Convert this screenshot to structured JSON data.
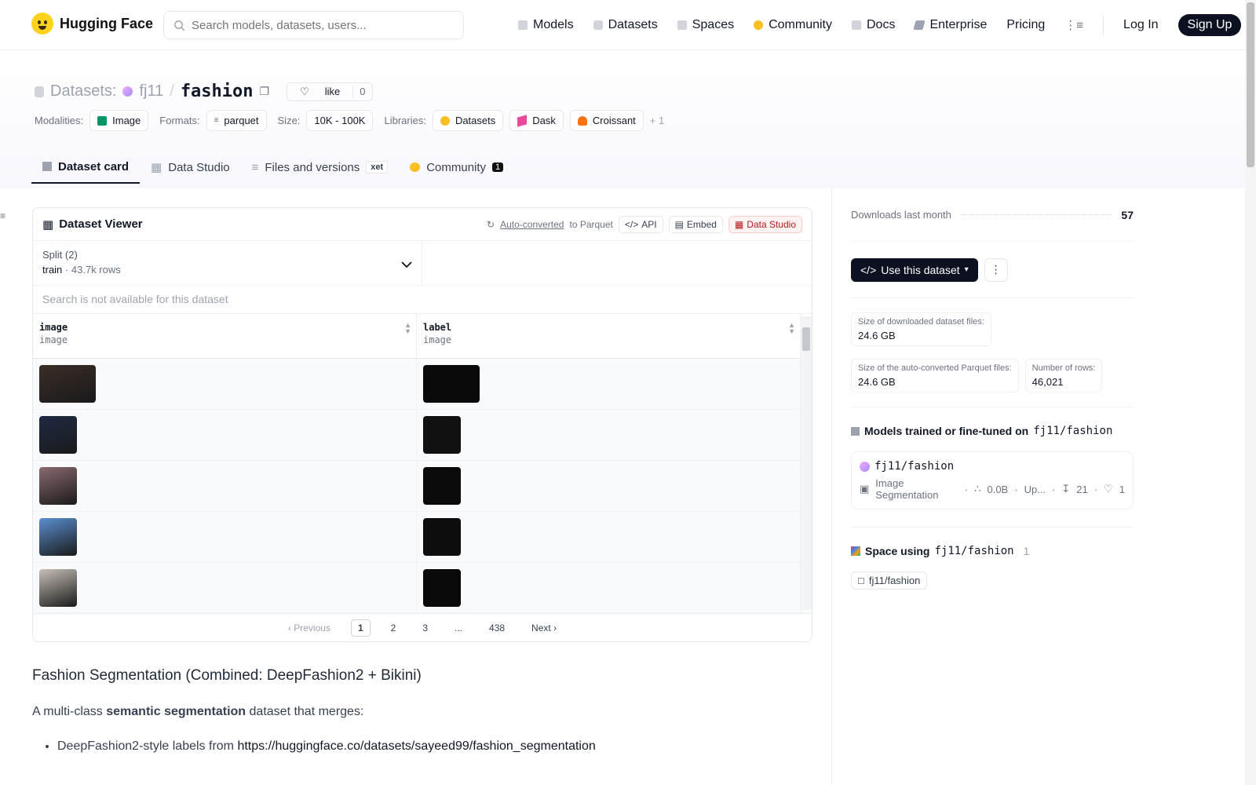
{
  "nav": {
    "logo_text": "Hugging Face",
    "search_placeholder": "Search models, datasets, users...",
    "links": [
      {
        "label": "Models",
        "icon": "cube-icon",
        "color": "#9ca3af"
      },
      {
        "label": "Datasets",
        "icon": "database-icon",
        "color": "#9ca3af"
      },
      {
        "label": "Spaces",
        "icon": "grid-icon",
        "color": "#9ca3af"
      },
      {
        "label": "Community",
        "icon": "community-icon",
        "color": "#fbbf24"
      },
      {
        "label": "Docs",
        "icon": "book-icon",
        "color": "#9ca3af"
      },
      {
        "label": "Enterprise",
        "icon": "enterprise-icon",
        "color": "#6b7280"
      },
      {
        "label": "Pricing"
      }
    ],
    "login": "Log In",
    "signup": "Sign Up"
  },
  "header": {
    "section": "Datasets:",
    "owner": "fj11",
    "repo": "fashion",
    "like_label": "like",
    "like_count": "0",
    "tags_labels": {
      "modalities": "Modalities:",
      "formats": "Formats:",
      "size": "Size:",
      "libraries": "Libraries:"
    },
    "modality": "Image",
    "format": "parquet",
    "size": "10K - 100K",
    "libraries": [
      "Datasets",
      "Dask",
      "Croissant"
    ],
    "more_libraries": "+ 1",
    "tabs": [
      {
        "label": "Dataset card",
        "active": true
      },
      {
        "label": "Data Studio"
      },
      {
        "label": "Files and versions",
        "badge": "xet"
      },
      {
        "label": "Community",
        "count": "1"
      }
    ]
  },
  "viewer": {
    "title": "Dataset Viewer",
    "auto_converted": "Auto-converted",
    "to_parquet": "to Parquet",
    "api": "API",
    "embed": "Embed",
    "data_studio": "Data Studio",
    "split_label": "Split (2)",
    "split_value": "train",
    "split_rows": "43.7k rows",
    "search_na": "Search is not available for this dataset",
    "columns": [
      {
        "name": "image",
        "type": "image"
      },
      {
        "name": "label",
        "type": "image"
      }
    ],
    "rows": [
      {
        "image_color": "#3a2e28",
        "label_color": "#0a0a0a",
        "wide": true
      },
      {
        "image_color": "#1e2a44",
        "label_color": "#111111",
        "wide": false
      },
      {
        "image_color": "#8a6a70",
        "label_color": "#0b0b0b",
        "wide": false
      },
      {
        "image_color": "#5a8fd0",
        "label_color": "#0d0d0d",
        "wide": false
      },
      {
        "image_color": "#c8c0b8",
        "label_color": "#0a0a0a",
        "wide": false
      }
    ],
    "pager": {
      "prev": "Previous",
      "pages": [
        "1",
        "2",
        "3",
        "...",
        "438"
      ],
      "next": "Next"
    }
  },
  "readme": {
    "heading": "Fashion Segmentation (Combined: DeepFashion2 + Bikini)",
    "intro_pre": "A multi-class ",
    "intro_bold": "semantic segmentation",
    "intro_post": " dataset that merges:",
    "bullet_pre": "DeepFashion2-style labels from ",
    "bullet_link": "https://huggingface.co/datasets/sayeed99/fashion_segmentation"
  },
  "sidebar": {
    "downloads_label": "Downloads last month",
    "downloads_value": "57",
    "use_dataset": "Use this dataset",
    "stats": [
      {
        "k": "Size of downloaded dataset files:",
        "v": "24.6 GB"
      },
      {
        "k": "Size of the auto-converted Parquet files:",
        "v": "24.6 GB"
      },
      {
        "k": "Number of rows:",
        "v": "46,021"
      }
    ],
    "models_title": "Models trained or fine-tuned on",
    "models_repo": "fj11/fashion",
    "model_name": "fj11/fashion",
    "model_task": "Image Segmentation",
    "model_params": "0.0B",
    "model_updated": "Up...",
    "model_downloads": "21",
    "model_likes": "1",
    "space_title": "Space using",
    "space_repo": "fj11/fashion",
    "space_count": "1",
    "space_chip": "fj11/fashion"
  }
}
